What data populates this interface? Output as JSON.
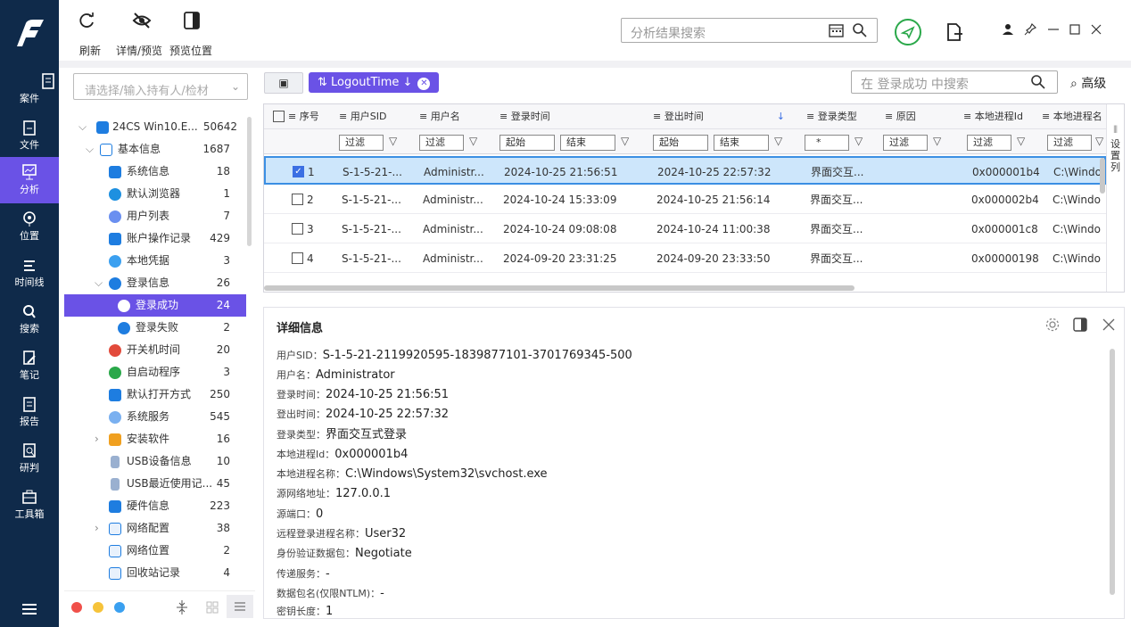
{
  "rail": {
    "items": [
      {
        "label": "案件",
        "icon": "document-icon"
      },
      {
        "label": "文件",
        "icon": "folder-icon"
      },
      {
        "label": "分析",
        "icon": "analysis-icon"
      },
      {
        "label": "位置",
        "icon": "location-icon"
      },
      {
        "label": "时间线",
        "icon": "timeline-icon"
      },
      {
        "label": "搜索",
        "icon": "search-icon"
      },
      {
        "label": "笔记",
        "icon": "note-icon"
      },
      {
        "label": "报告",
        "icon": "report-icon"
      },
      {
        "label": "研判",
        "icon": "judge-icon"
      },
      {
        "label": "工具箱",
        "icon": "toolbox-icon"
      }
    ],
    "active_index": 2
  },
  "toolbar": {
    "refresh_label": "刷新",
    "detail_preview_label": "详情/预览",
    "preview_position_label": "预览位置",
    "search_placeholder": "分析结果搜索"
  },
  "tree": {
    "select_placeholder": "请选择/输入持有人/检材",
    "rows": [
      {
        "label": "24CS Win10.E...",
        "count": "50642"
      },
      {
        "label": "基本信息",
        "count": "1687"
      },
      {
        "label": "系统信息",
        "count": "18"
      },
      {
        "label": "默认浏览器",
        "count": "1"
      },
      {
        "label": "用户列表",
        "count": "7"
      },
      {
        "label": "账户操作记录",
        "count": "429"
      },
      {
        "label": "本地凭据",
        "count": "3"
      },
      {
        "label": "登录信息",
        "count": "26"
      },
      {
        "label": "登录成功",
        "count": "24"
      },
      {
        "label": "登录失败",
        "count": "2"
      },
      {
        "label": "开关机时间",
        "count": "20"
      },
      {
        "label": "自启动程序",
        "count": "3"
      },
      {
        "label": "默认打开方式",
        "count": "250"
      },
      {
        "label": "系统服务",
        "count": "545"
      },
      {
        "label": "安装软件",
        "count": "16"
      },
      {
        "label": "USB设备信息",
        "count": "10"
      },
      {
        "label": "USB最近使用记...",
        "count": "45"
      },
      {
        "label": "硬件信息",
        "count": "223"
      },
      {
        "label": "网络配置",
        "count": "38"
      },
      {
        "label": "网络位置",
        "count": "2"
      },
      {
        "label": "回收站记录",
        "count": "4"
      }
    ]
  },
  "grid": {
    "sort_chip": "LogoutTime ↓",
    "search_placeholder": "在 登录成功 中搜索",
    "advanced_label": "高级",
    "headers": {
      "seq": "序号",
      "sid": "用户SID",
      "user": "用户名",
      "login": "登录时间",
      "logout": "登出时间",
      "type": "登录类型",
      "reason": "原因",
      "pid": "本地进程Id",
      "pname": "本地进程名"
    },
    "filters": {
      "filter": "过滤",
      "start": "起始",
      "end": "结束",
      "type_value": "*"
    },
    "column_settings": "设置列",
    "rows": [
      {
        "seq": "1",
        "sid": "S-1-5-21-...",
        "user": "Administr...",
        "login": "2024-10-25 21:56:51",
        "logout": "2024-10-25 22:57:32",
        "type": "界面交互...",
        "reason": "",
        "pid": "0x000001b4",
        "pname": "C:\\Windo"
      },
      {
        "seq": "2",
        "sid": "S-1-5-21-...",
        "user": "Administr...",
        "login": "2024-10-24 15:33:09",
        "logout": "2024-10-25 21:56:14",
        "type": "界面交互...",
        "reason": "",
        "pid": "0x000002b4",
        "pname": "C:\\Windo"
      },
      {
        "seq": "3",
        "sid": "S-1-5-21-...",
        "user": "Administr...",
        "login": "2024-10-24 09:08:08",
        "logout": "2024-10-24 11:00:38",
        "type": "界面交互...",
        "reason": "",
        "pid": "0x000001c8",
        "pname": "C:\\Windo"
      },
      {
        "seq": "4",
        "sid": "S-1-5-21-...",
        "user": "Administr...",
        "login": "2024-09-20 23:31:25",
        "logout": "2024-09-20 23:33:50",
        "type": "界面交互...",
        "reason": "",
        "pid": "0x00000198",
        "pname": "C:\\Windo"
      }
    ]
  },
  "detail": {
    "title": "详细信息",
    "fields": [
      {
        "k": "用户SID：",
        "v": "S-1-5-21-2119920595-1839877101-3701769345-500"
      },
      {
        "k": "用户名：",
        "v": "Administrator"
      },
      {
        "k": "登录时间：",
        "v": "2024-10-25 21:56:51"
      },
      {
        "k": "登出时间：",
        "v": "2024-10-25 22:57:32"
      },
      {
        "k": "登录类型：",
        "v": "界面交互式登录"
      },
      {
        "k": "本地进程Id：",
        "v": "0x000001b4"
      },
      {
        "k": "本地进程名称：",
        "v": "C:\\Windows\\System32\\svchost.exe"
      },
      {
        "k": "源网络地址：",
        "v": "127.0.0.1"
      },
      {
        "k": "源端口：",
        "v": "0"
      },
      {
        "k": "远程登录进程名称：",
        "v": "User32"
      },
      {
        "k": "身份验证数据包：",
        "v": "Negotiate"
      },
      {
        "k": "传递服务：",
        "v": "-"
      },
      {
        "k": "数据包名(仅限NTLM)：",
        "v": "-"
      },
      {
        "k": "密钥长度：",
        "v": "1"
      }
    ]
  },
  "colors": {
    "rail_bg": "#0f2a4a",
    "accent": "#6a52e6",
    "row_selected": "#cde6fb"
  }
}
